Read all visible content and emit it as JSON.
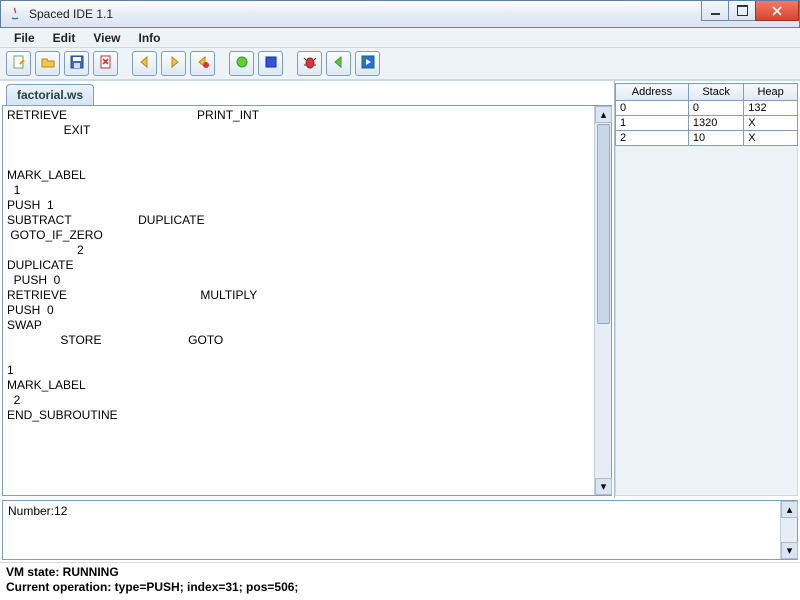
{
  "window": {
    "title": "Spaced IDE 1.1"
  },
  "menu": {
    "items": [
      "File",
      "Edit",
      "View",
      "Info"
    ]
  },
  "toolbar": {
    "buttons": [
      {
        "name": "new-file",
        "icon": "new"
      },
      {
        "name": "open-file",
        "icon": "open"
      },
      {
        "name": "save-file",
        "icon": "save"
      },
      {
        "name": "close-file",
        "icon": "closex"
      },
      {
        "sep": true
      },
      {
        "name": "step-back",
        "icon": "arrow-left-yellow"
      },
      {
        "name": "step-forward",
        "icon": "arrow-right-yellow"
      },
      {
        "name": "debug-back",
        "icon": "bug-left"
      },
      {
        "sep": true
      },
      {
        "name": "run",
        "icon": "circle-green"
      },
      {
        "name": "stop",
        "icon": "square-blue"
      },
      {
        "sep": true
      },
      {
        "name": "debug",
        "icon": "bug-red"
      },
      {
        "name": "resume",
        "icon": "arrow-left-green"
      },
      {
        "name": "play",
        "icon": "play-blue"
      }
    ]
  },
  "tabs": [
    {
      "label": "factorial.ws"
    }
  ],
  "editor_text": "RETRIEVE                                       PRINT_INT\n                 EXIT\n\n\nMARK_LABEL\n  1\nPUSH  1\nSUBTRACT                    DUPLICATE\n GOTO_IF_ZERO\n                     2\nDUPLICATE\n  PUSH  0\nRETRIEVE                                        MULTIPLY\nPUSH  0\nSWAP\n                STORE                          GOTO\n\n1\nMARK_LABEL\n  2\nEND_SUBROUTINE",
  "memory": {
    "headers": [
      "Address",
      "Stack",
      "Heap"
    ],
    "rows": [
      {
        "addr": "0",
        "stack": "0",
        "heap": "132"
      },
      {
        "addr": "1",
        "stack": "1320",
        "heap": "X"
      },
      {
        "addr": "2",
        "stack": "10",
        "heap": "X"
      }
    ]
  },
  "console": {
    "text": "Number:12"
  },
  "status": {
    "vm_state": "VM state: RUNNING",
    "current_op": "Current operation: type=PUSH; index=31; pos=506;"
  }
}
